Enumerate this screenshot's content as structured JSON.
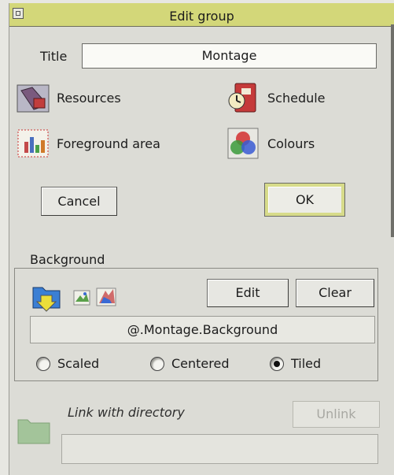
{
  "window": {
    "title": "Edit group"
  },
  "form": {
    "title_label": "Title",
    "title_value": "Montage"
  },
  "options": [
    {
      "label": "Resources",
      "icon": "resources-icon"
    },
    {
      "label": "Schedule",
      "icon": "schedule-clock-icon"
    },
    {
      "label": "Foreground area",
      "icon": "foreground-area-icon"
    },
    {
      "label": "Colours",
      "icon": "colours-icon"
    }
  ],
  "buttons": {
    "cancel": "Cancel",
    "ok": "OK"
  },
  "background": {
    "frame_title": "Background",
    "edit": "Edit",
    "clear": "Clear",
    "path": "@.Montage.Background",
    "modes": [
      {
        "label": "Scaled",
        "selected": false
      },
      {
        "label": "Centered",
        "selected": false
      },
      {
        "label": "Tiled",
        "selected": true
      }
    ]
  },
  "link": {
    "label": "Link with directory",
    "unlink": "Unlink",
    "directory_value": ""
  },
  "colors": {
    "titlebar": "#d3d779",
    "ok_highlight": "#d7db8a",
    "folder_green": "#a3c49a"
  }
}
